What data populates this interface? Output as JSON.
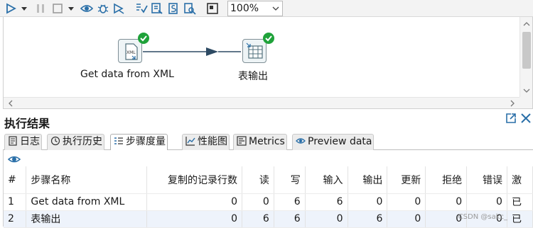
{
  "toolbar": {
    "items": [
      "run-icon",
      "pause-icon",
      "stop-icon",
      "preview-icon",
      "debug-icon",
      "replay-icon",
      "verify-icon",
      "impact-icon",
      "sql-icon",
      "explore-db-icon",
      "align-icon"
    ],
    "zoom": "100%"
  },
  "canvas": {
    "steps": [
      {
        "label": "Get data from XML",
        "icon": "xml-input-icon",
        "status": "success"
      },
      {
        "label": "表输出",
        "icon": "table-output-icon",
        "status": "success"
      }
    ]
  },
  "results": {
    "title": "执行结果",
    "tabs": [
      {
        "label": "日志",
        "icon": "log-icon"
      },
      {
        "label": "执行历史",
        "icon": "history-icon"
      },
      {
        "label": "步骤度量",
        "icon": "step-metrics-icon",
        "active": true
      },
      {
        "label": "性能图",
        "icon": "perf-graph-icon"
      },
      {
        "label": "Metrics",
        "icon": "metrics-icon"
      },
      {
        "label": "Preview data",
        "icon": "preview-eye-icon"
      }
    ],
    "columns": [
      "#",
      "步骤名称",
      "复制的记录行数",
      "读",
      "写",
      "输入",
      "输出",
      "更新",
      "拒绝",
      "错误",
      "激"
    ],
    "rows": [
      [
        "1",
        "Get data from XML",
        "0",
        "0",
        "6",
        "6",
        "0",
        "0",
        "0",
        "0",
        "已"
      ],
      [
        "2",
        "表输出",
        "0",
        "6",
        "6",
        "0",
        "6",
        "0",
        "0",
        "0",
        "已"
      ]
    ]
  },
  "watermark": "CSDN @sakc_"
}
